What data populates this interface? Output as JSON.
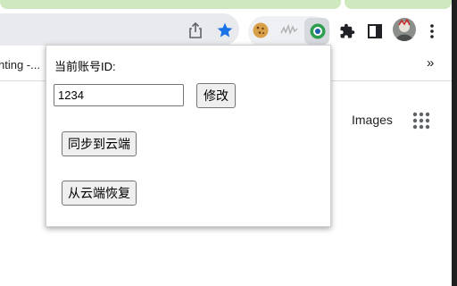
{
  "toolbar": {
    "share_icon": "share-icon",
    "bookmark_star_icon": "star-icon",
    "extensions": [
      "cookie-extension-icon",
      "wave-extension-icon",
      "sync-extension-icon"
    ],
    "puzzle_icon": "extensions-puzzle-icon",
    "side_panel_icon": "side-panel-icon",
    "menu_icon": "kebab-menu-icon",
    "star_color": "#1a73e8",
    "active_extension_color": "#2e9e4f"
  },
  "bookmarks": {
    "item_label": "hting -...",
    "overflow_label": "»"
  },
  "page": {
    "images_link": "Images",
    "apps_icon": "google-apps-grid-icon"
  },
  "popup": {
    "account_label": "当前账号ID:",
    "account_id_value": "1234",
    "modify_button": "修改",
    "sync_button": "同步到云端",
    "restore_button": "从云端恢复"
  }
}
